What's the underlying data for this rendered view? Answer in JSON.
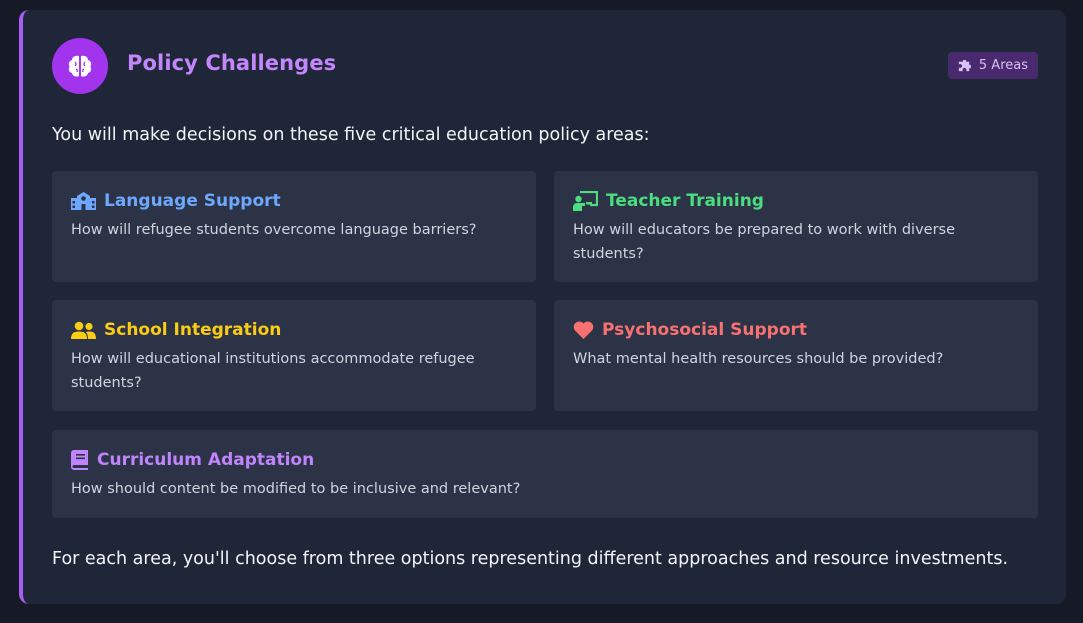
{
  "header": {
    "title": "Policy Challenges",
    "icon": "brain-icon",
    "badge_label": "5 Areas",
    "badge_icon": "puzzle-icon"
  },
  "intro_text": "You will make decisions on these five critical education policy areas:",
  "areas": [
    {
      "title": "Language Support",
      "description": "How will refugee students overcome language barriers?",
      "icon": "school-icon",
      "color": "#6ea8fe"
    },
    {
      "title": "Teacher Training",
      "description": "How will educators be prepared to work with diverse students?",
      "icon": "chalkboard-teacher-icon",
      "color": "#4ade80"
    },
    {
      "title": "School Integration",
      "description": "How will educational institutions accommodate refugee students?",
      "icon": "users-icon",
      "color": "#facc15"
    },
    {
      "title": "Psychosocial Support",
      "description": "What mental health resources should be provided?",
      "icon": "heart-icon",
      "color": "#f87171"
    },
    {
      "title": "Curriculum Adaptation",
      "description": "How should content be modified to be inclusive and relevant?",
      "icon": "book-icon",
      "color": "#c084fc"
    }
  ],
  "outro_text": "For each area, you'll choose from three options representing different approaches and resource investments.",
  "colors": {
    "accent": "#a65df0",
    "title": "#c387fb",
    "panel": "#1f2637",
    "card": "#2c3346",
    "badge_bg": "#4a2a6e"
  }
}
